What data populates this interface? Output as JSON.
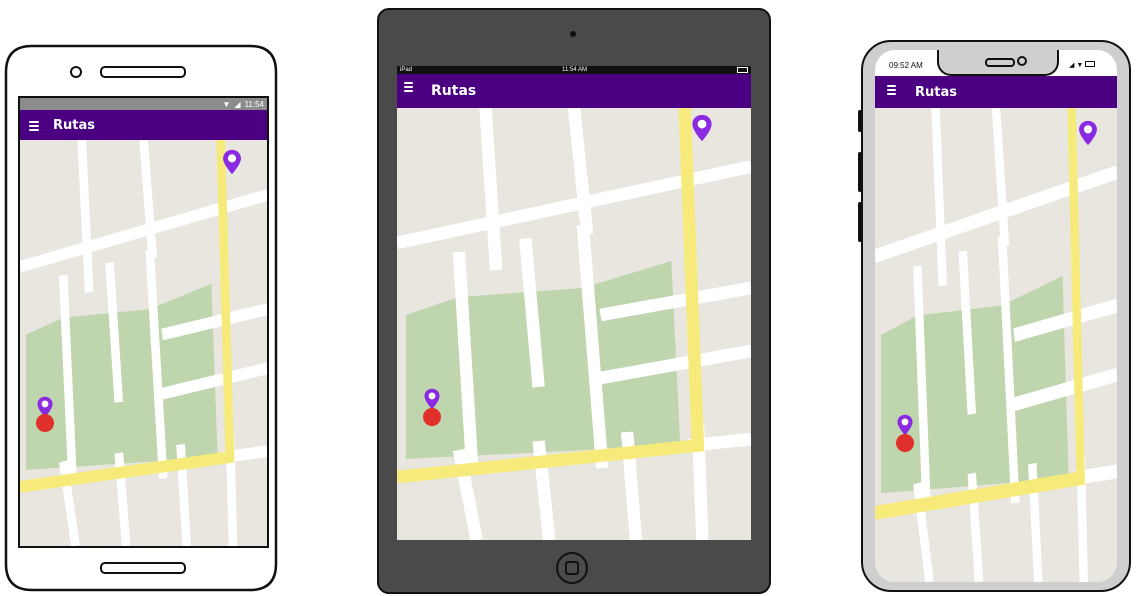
{
  "colors": {
    "appbar": "#4b0082",
    "route": "#f6eb7a",
    "street": "#ffffff",
    "park": "#bfd5ae",
    "ground": "#e9e6e0",
    "pin": "#8a2be2",
    "origin": "#e0302b",
    "tablet_frame": "#4a4a4a"
  },
  "android": {
    "status_time": "11:54",
    "appbar": {
      "menu_icon": "hamburger-menu-icon",
      "title": "Rutas"
    }
  },
  "tablet": {
    "status_left": "iPad",
    "status_time": "11:54 AM",
    "appbar": {
      "menu_icon": "hamburger-menu-icon",
      "title": "Rutas"
    }
  },
  "iphone": {
    "status_time": "09:52 AM",
    "appbar": {
      "menu_icon": "hamburger-menu-icon",
      "title": "Rutas"
    }
  }
}
